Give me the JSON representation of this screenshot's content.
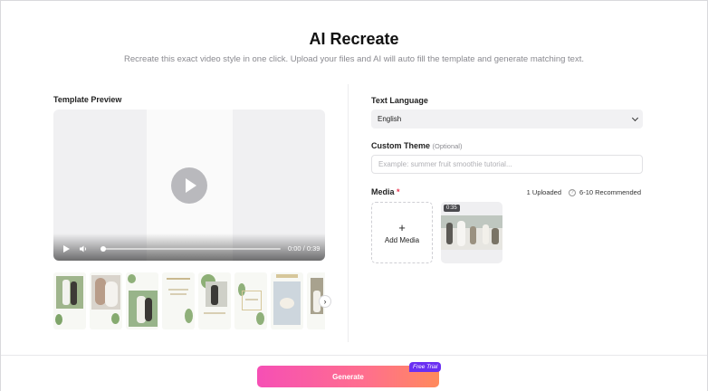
{
  "header": {
    "title": "AI Recreate",
    "subtitle": "Recreate this exact video style in one click. Upload your files and AI will auto fill the template and generate matching text."
  },
  "template_preview": {
    "label": "Template Preview",
    "timecode": "0:00 / 0:39",
    "progress_fraction": 0.0
  },
  "text_language": {
    "label": "Text Language",
    "selected": "English"
  },
  "custom_theme": {
    "label": "Custom Theme",
    "optional": "(Optional)",
    "placeholder": "Example: summer fruit smoothie tutorial..."
  },
  "media": {
    "label": "Media",
    "required_mark": "*",
    "uploaded": "1 Uploaded",
    "recommended": "6-10 Recommended",
    "add_label": "Add Media",
    "add_symbol": "+",
    "tiles": [
      {
        "duration": "0:35"
      }
    ]
  },
  "footer": {
    "generate_label": "Generate",
    "badge": "Free Trial"
  },
  "icons": {
    "play": "play-icon",
    "volume": "volume-icon",
    "next": "chevron-right-icon",
    "info": "question-circle-icon",
    "dropdown": "chevron-down-icon"
  },
  "colors": {
    "accent_gradient_start": "#f64fb5",
    "accent_gradient_end": "#ff8a5c",
    "badge": "#6a2ff2",
    "required": "#e8344e"
  }
}
